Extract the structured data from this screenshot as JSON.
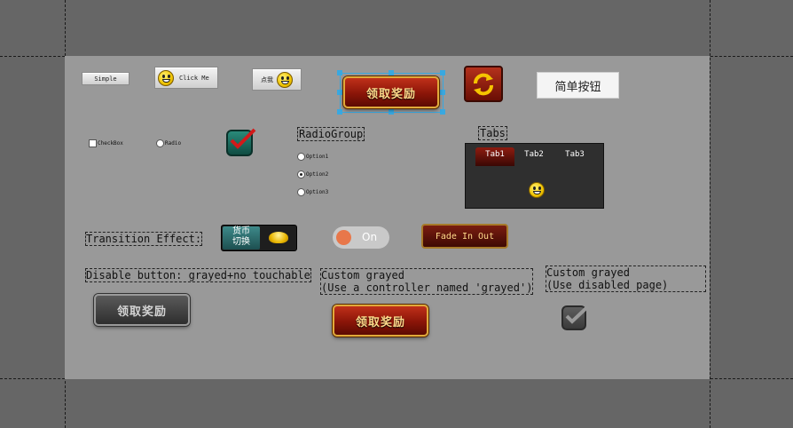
{
  "buttons": {
    "simple_label": "Simple",
    "click_me_label": "Click Me",
    "dianwo_label": "点我",
    "reward_label": "领取奖励",
    "simple_cn_label": "简单按钮"
  },
  "checkbox": {
    "label": "CheckBox"
  },
  "radio": {
    "label": "Radio"
  },
  "radio_group": {
    "title": "RadioGroup",
    "options": [
      "Option1",
      "Option2",
      "Option3"
    ],
    "selected_index": 1
  },
  "tabs": {
    "title": "Tabs",
    "items": [
      "Tab1",
      "Tab2",
      "Tab3"
    ],
    "active_index": 0
  },
  "transition": {
    "label": "Transition Effect:",
    "currency_label_top": "货币",
    "currency_label_bottom": "切换"
  },
  "toggle": {
    "label": "On",
    "state": true
  },
  "fade_button": {
    "label": "Fade In Out"
  },
  "disabled": {
    "label": "Disable button: grayed+no touchable",
    "button_label": "领取奖励"
  },
  "custom_grayed": {
    "label": "Custom grayed\n(Use a controller named 'grayed')",
    "button_label": "领取奖励"
  },
  "custom_grayed_page": {
    "label": "Custom grayed\n(Use disabled page)"
  },
  "colors": {
    "background": "#666666",
    "stage": "#999999",
    "reward_red": "#a01e0e",
    "gold_border": "#e0a93a",
    "selection_blue": "#39a8e0",
    "toggle_orange": "#e8774a"
  }
}
